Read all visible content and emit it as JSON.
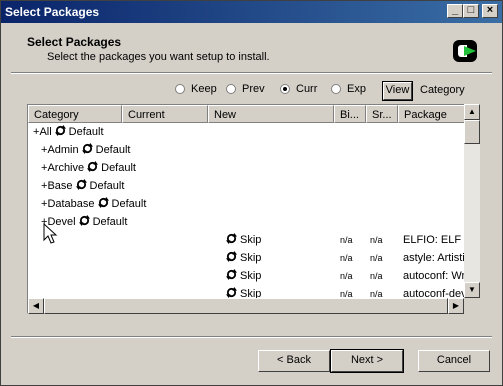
{
  "window": {
    "title": "Select Packages"
  },
  "titlebar_buttons": [
    "_",
    "□",
    "×"
  ],
  "header": {
    "title": "Select Packages",
    "subtitle": "Select the packages you want setup to install."
  },
  "view_options": {
    "radios": [
      {
        "label": "Keep",
        "selected": false
      },
      {
        "label": "Prev",
        "selected": false
      },
      {
        "label": "Curr",
        "selected": true
      },
      {
        "label": "Exp",
        "selected": false
      }
    ],
    "view_button": "View",
    "view_mode": "Category"
  },
  "columns": [
    "Category",
    "Current",
    "New",
    "Bi...",
    "Sr...",
    "Package"
  ],
  "categories": [
    {
      "toggle": "+",
      "name": "All",
      "action": "Default"
    },
    {
      "toggle": "+",
      "name": "Admin",
      "action": "Default"
    },
    {
      "toggle": "+",
      "name": "Archive",
      "action": "Default"
    },
    {
      "toggle": "+",
      "name": "Base",
      "action": "Default"
    },
    {
      "toggle": "+",
      "name": "Database",
      "action": "Default"
    },
    {
      "toggle": "+",
      "name": "Devel",
      "action": "Default"
    }
  ],
  "packages": [
    {
      "new": "Skip",
      "bin": "n/a",
      "src": "n/a",
      "package": "ELFIO: ELF f"
    },
    {
      "new": "Skip",
      "bin": "n/a",
      "src": "n/a",
      "package": "astyle: Artisti"
    },
    {
      "new": "Skip",
      "bin": "n/a",
      "src": "n/a",
      "package": "autoconf: Wr"
    },
    {
      "new": "Skip",
      "bin": "n/a",
      "src": "n/a",
      "package": "autoconf-dev"
    }
  ],
  "buttons": {
    "back": "< Back",
    "next": "Next >",
    "cancel": "Cancel"
  },
  "icons": {
    "cycle": "cycle-arrows-icon",
    "logo": "cygwin-logo-icon",
    "cursor": "mouse-pointer-icon"
  }
}
